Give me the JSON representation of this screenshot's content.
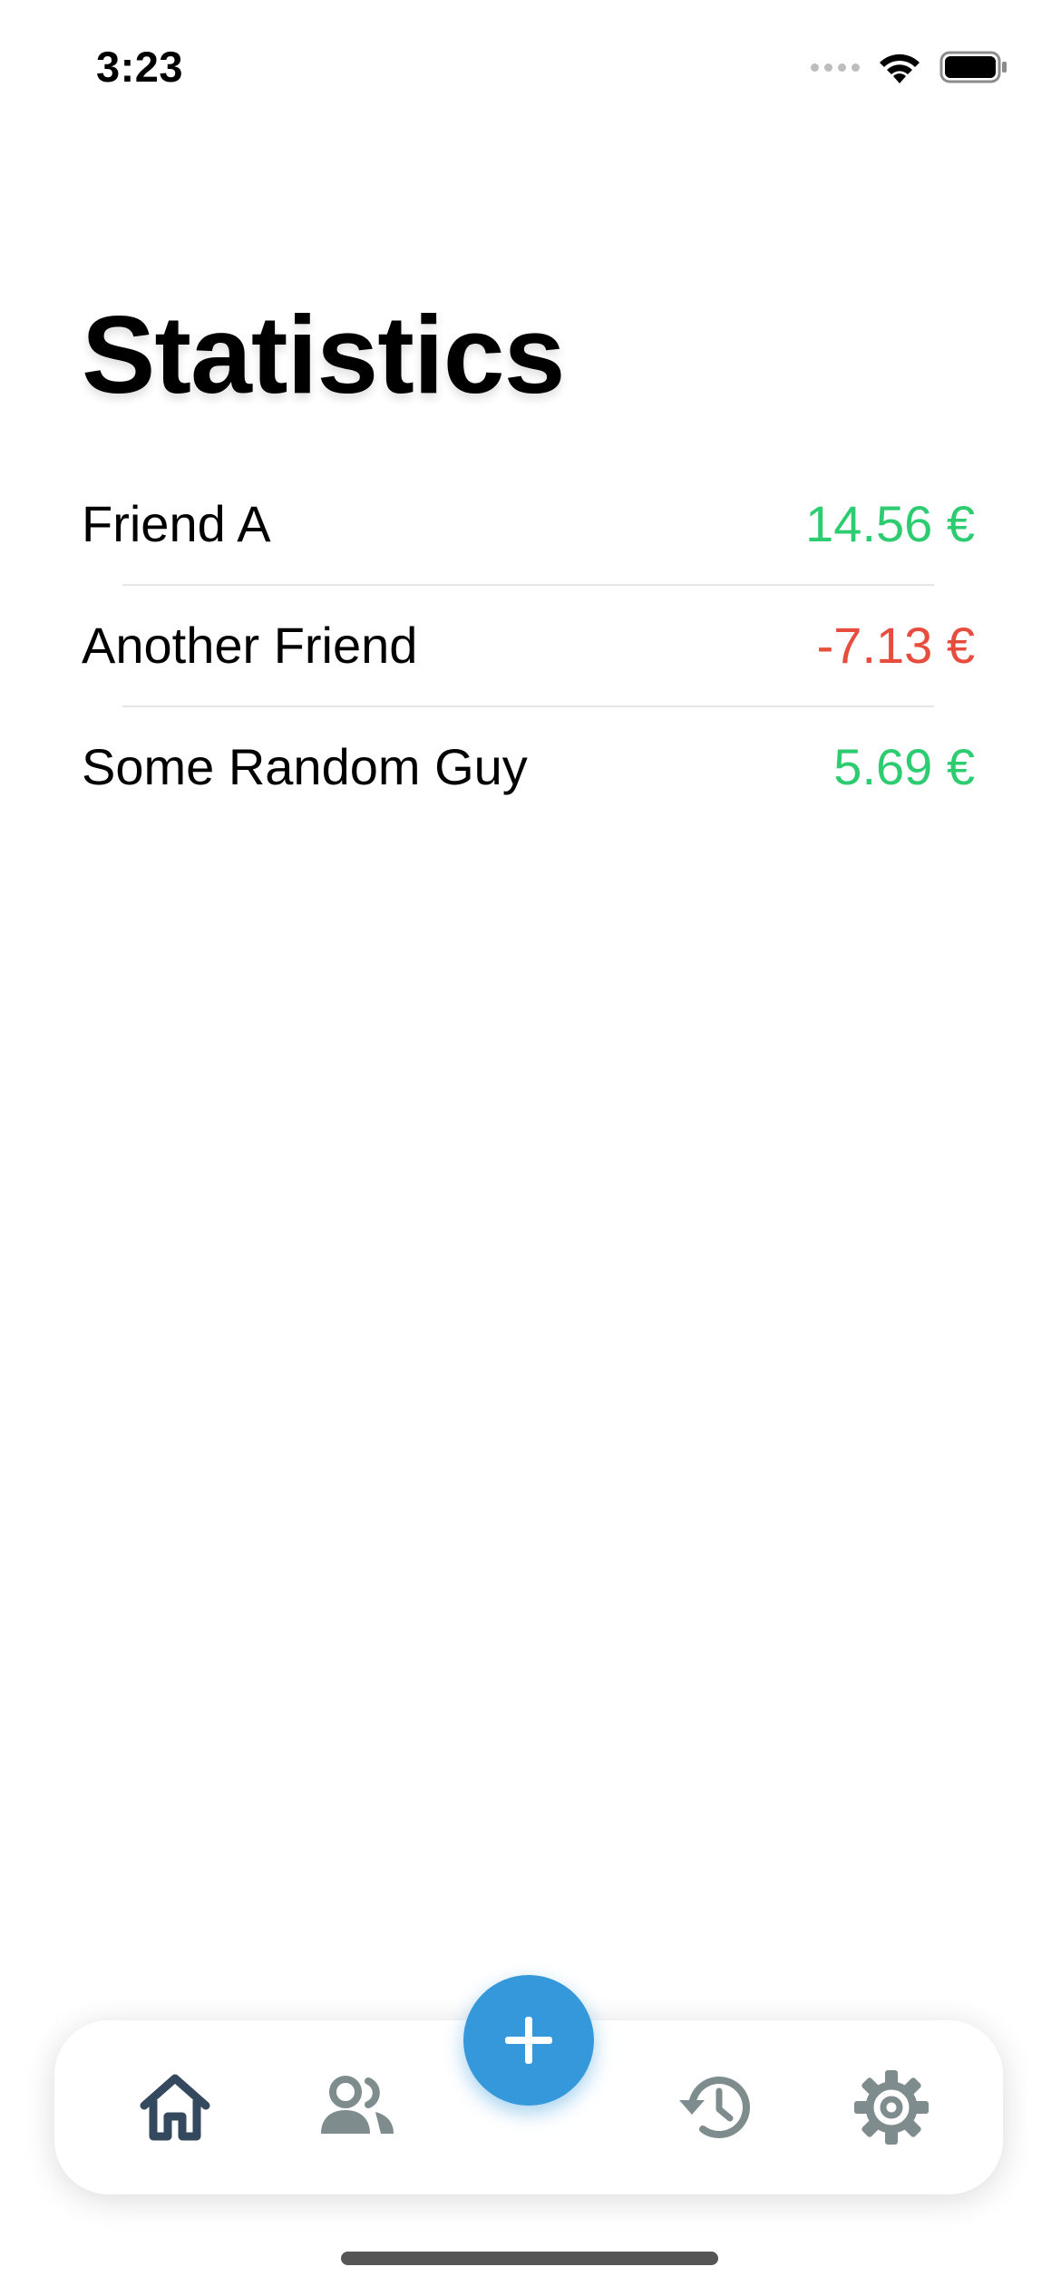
{
  "status_bar": {
    "time": "3:23"
  },
  "page": {
    "title": "Statistics"
  },
  "friends": [
    {
      "name": "Friend A",
      "amount": "14.56 €",
      "balance": "positive"
    },
    {
      "name": "Another Friend",
      "amount": "-7.13 €",
      "balance": "negative"
    },
    {
      "name": "Some Random Guy",
      "amount": "5.69 €",
      "balance": "positive"
    }
  ],
  "colors": {
    "positive": "#2ecc71",
    "negative": "#e74c3c",
    "accent": "#3498db",
    "tab_active": "#34495e",
    "tab_inactive": "#7f8c8d"
  },
  "tab_bar": {
    "items": [
      {
        "icon": "home-icon",
        "active": true
      },
      {
        "icon": "users-icon",
        "active": false
      },
      {
        "icon": "history-icon",
        "active": false
      },
      {
        "icon": "gear-icon",
        "active": false
      }
    ],
    "center_button_icon": "plus-icon"
  }
}
